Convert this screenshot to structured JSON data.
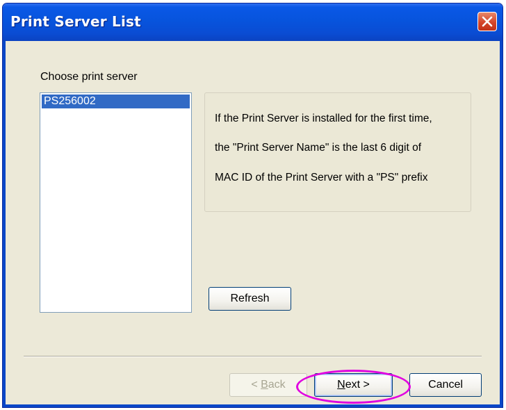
{
  "window": {
    "title": "Print Server List",
    "close_icon": "close-icon"
  },
  "server_picker": {
    "label": "Choose print server",
    "items": [
      "PS256002"
    ],
    "selected": "PS256002"
  },
  "info": {
    "lines": [
      "If the Print Server is installed for the first time,",
      "the \"Print Server Name\" is the last 6 digit of",
      "MAC ID of the Print Server with a \"PS\" prefix"
    ]
  },
  "buttons": {
    "refresh": "Refresh",
    "back_prefix": "< ",
    "back_mnemonic": "B",
    "back_rest": "ack",
    "next_mnemonic": "N",
    "next_rest": "ext >",
    "cancel": "Cancel"
  },
  "colors": {
    "titlebar": "#0754dd",
    "selection": "#316ac5",
    "highlight_ellipse": "#e000e0",
    "close_button": "#d4452a"
  }
}
